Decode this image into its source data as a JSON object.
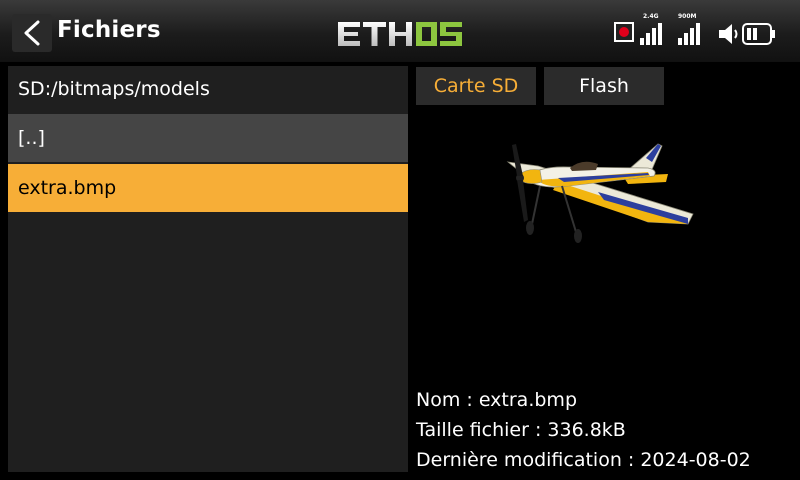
{
  "header": {
    "title": "Fichiers",
    "logo_text": "ETHOS",
    "signal_1_label": "2.4G",
    "signal_2_label": "900M",
    "icons": [
      "back-arrow-icon",
      "record-icon",
      "signal-icon",
      "speaker-icon",
      "battery-icon"
    ]
  },
  "browser": {
    "path": "SD:/bitmaps/models",
    "items": [
      {
        "label": "[..]"
      },
      {
        "label": "extra.bmp",
        "selected": true
      }
    ]
  },
  "tabs": {
    "sd": "Carte SD",
    "flash": "Flash",
    "active": "sd"
  },
  "details": {
    "name": "Nom : extra.bmp",
    "size": "Taille fichier : 336.8kB",
    "modified": "Dernière modification : 2024-08-02"
  },
  "colors": {
    "accent": "#f7ae37",
    "logo_green": "#8dc63f",
    "row_highlight": "#454545",
    "panel": "#1f1f1f",
    "record": "#e0001b"
  }
}
